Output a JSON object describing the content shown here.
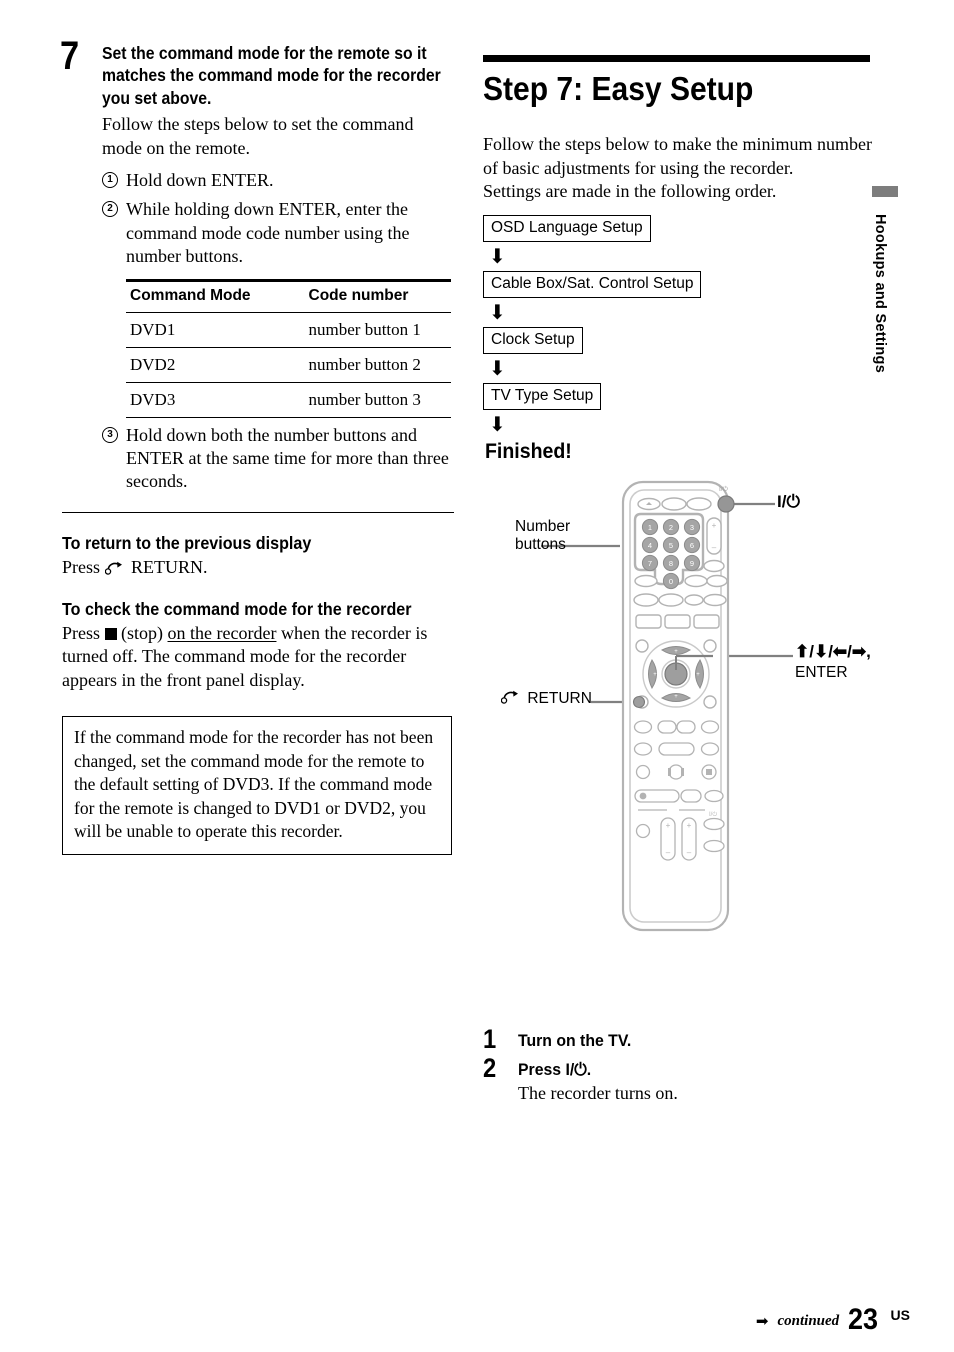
{
  "left": {
    "step": {
      "number": "7",
      "title": "Set the command mode for the remote so it matches the command mode for the recorder you set above.",
      "body": "Follow the steps below to set the command mode on the remote.",
      "substeps": [
        {
          "marker": "1",
          "text": "Hold down ENTER."
        },
        {
          "marker": "2",
          "text": "While holding down ENTER, enter the command mode code number using the number buttons."
        },
        {
          "marker": "3",
          "text": "Hold down both the number buttons and ENTER at the same time for more than three seconds."
        }
      ]
    },
    "table": {
      "headers": [
        "Command Mode",
        "Code number"
      ],
      "rows": [
        [
          "DVD1",
          "number button 1"
        ],
        [
          "DVD2",
          "number button 2"
        ],
        [
          "DVD3",
          "number button 3"
        ]
      ]
    },
    "return_section": {
      "heading": "To return to the previous display",
      "press_word": "Press",
      "return_label": "RETURN.",
      "icon": "return-arrow-icon"
    },
    "check_section": {
      "heading": "To check the command mode for the recorder",
      "press_word": "Press",
      "stop_icon": "stop-square-icon",
      "stop_label": "(stop)",
      "underlined": "on the recorder",
      "rest": " when the recorder is turned off. The command mode for the recorder appears in the front panel display."
    },
    "note": "If the command mode for the recorder has not been changed, set the command mode for the remote to the default setting of DVD3. If the command mode for the remote is changed to DVD1 or DVD2, you will be unable to operate this recorder."
  },
  "right": {
    "title": "Step 7: Easy Setup",
    "intro": "Follow the steps below to make the minimum number of basic adjustments for using the recorder.\nSettings are made in the following order.",
    "flow": [
      "OSD Language Setup",
      "Cable Box/Sat. Control Setup",
      "Clock Setup",
      "TV Type Setup"
    ],
    "flow_arrow": "⬇",
    "finished": "Finished!",
    "remote_labels": {
      "number_buttons": "Number\nbuttons",
      "power": "I/⏻",
      "dpad": "⬆/⬇/⬅/➡,",
      "enter": "ENTER",
      "return": "RETURN",
      "return_icon": "return-arrow-icon"
    },
    "remote_keys": {
      "numbers": [
        "1",
        "2",
        "3",
        "4",
        "5",
        "6",
        "7",
        "8",
        "9",
        "0"
      ]
    },
    "final_steps": [
      {
        "number": "1",
        "title": "Turn on the TV.",
        "detail": ""
      },
      {
        "number": "2",
        "title": "Press I/⏻.",
        "detail": "The recorder turns on."
      }
    ]
  },
  "side_tab": {
    "label": "Hookups and Settings",
    "bar_color": "#7d7d7d"
  },
  "footer": {
    "continued": "continued",
    "arrow": "➡",
    "page": "23",
    "suffix": "US"
  }
}
